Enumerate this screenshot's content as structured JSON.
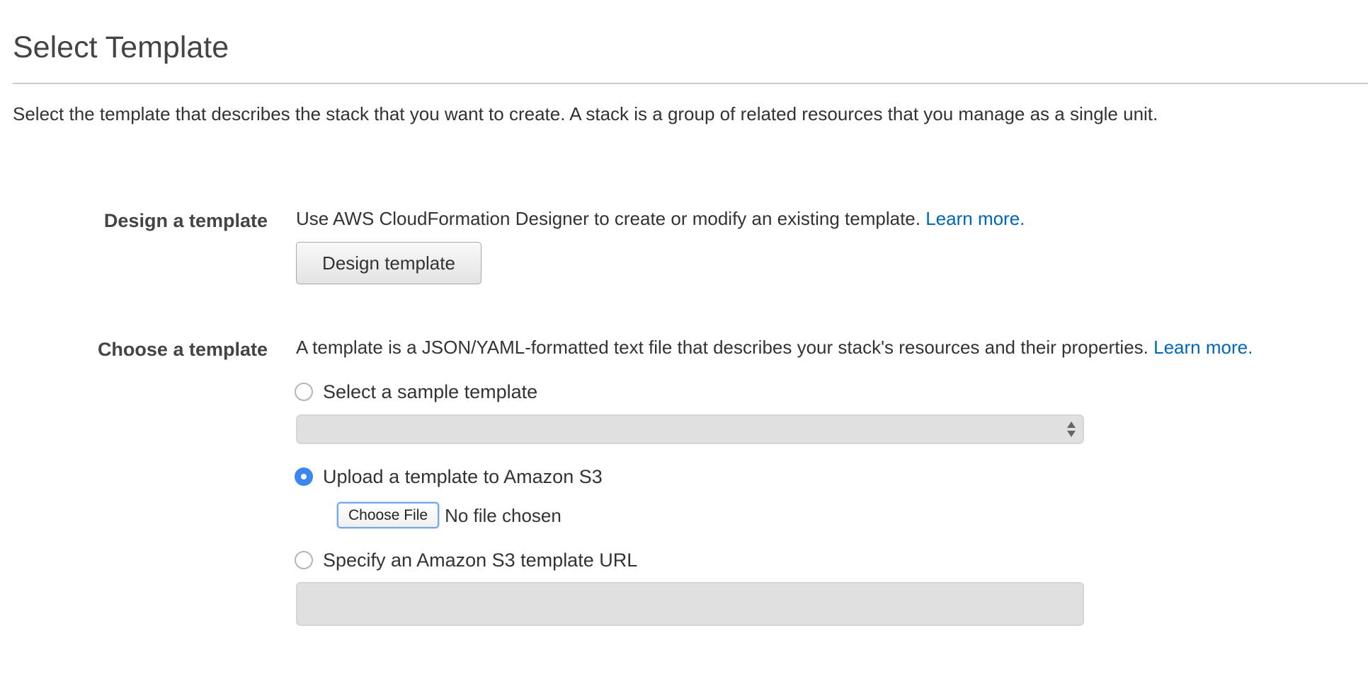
{
  "page": {
    "title": "Select Template",
    "intro": "Select the template that describes the stack that you want to create. A stack is a group of related resources that you manage as a single unit."
  },
  "design_section": {
    "label": "Design a template",
    "description": "Use AWS CloudFormation Designer to create or modify an existing template.",
    "learn_more": "Learn more.",
    "button_label": "Design template"
  },
  "choose_section": {
    "label": "Choose a template",
    "description": "A template is a JSON/YAML-formatted text file that describes your stack's resources and their properties.",
    "learn_more": "Learn more.",
    "options": [
      {
        "label": "Select a sample template",
        "selected": false
      },
      {
        "label": "Upload a template to Amazon S3",
        "selected": true
      },
      {
        "label": "Specify an Amazon S3 template URL",
        "selected": false
      }
    ],
    "sample_select_value": "",
    "file_button_label": "Choose File",
    "file_status": "No file chosen",
    "url_value": ""
  },
  "colors": {
    "link": "#0066b8",
    "radio_selected": "#3b86f0",
    "disabled_field": "#e0e0e0"
  }
}
